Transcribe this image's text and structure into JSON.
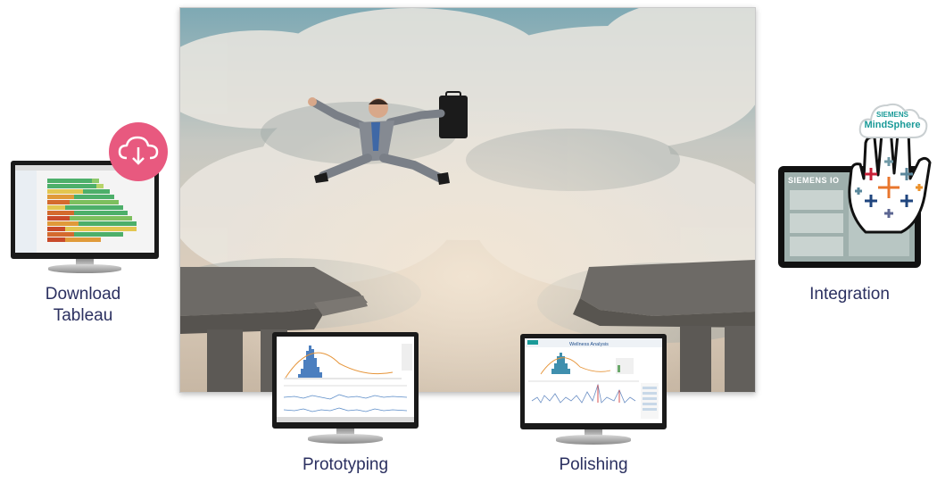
{
  "captions": {
    "download_line1": "Download",
    "download_line2": "Tableau",
    "prototyping": "Prototyping",
    "polishing": "Polishing",
    "integration": "Integration"
  },
  "integration_screen": {
    "brand": "SIEMENS",
    "brand_suffix": "IO",
    "cloud_line1": "SIEMENS",
    "cloud_line2": "MindSphere"
  },
  "polishing_screen": {
    "title": "Wellness Analysis"
  },
  "colors": {
    "caption": "#2b3060",
    "download_badge": "#e8597f",
    "mindsphere_teal": "#1a9a98"
  },
  "icons": {
    "download": "cloud-download-icon",
    "tableau": "tableau-logo-icon"
  }
}
